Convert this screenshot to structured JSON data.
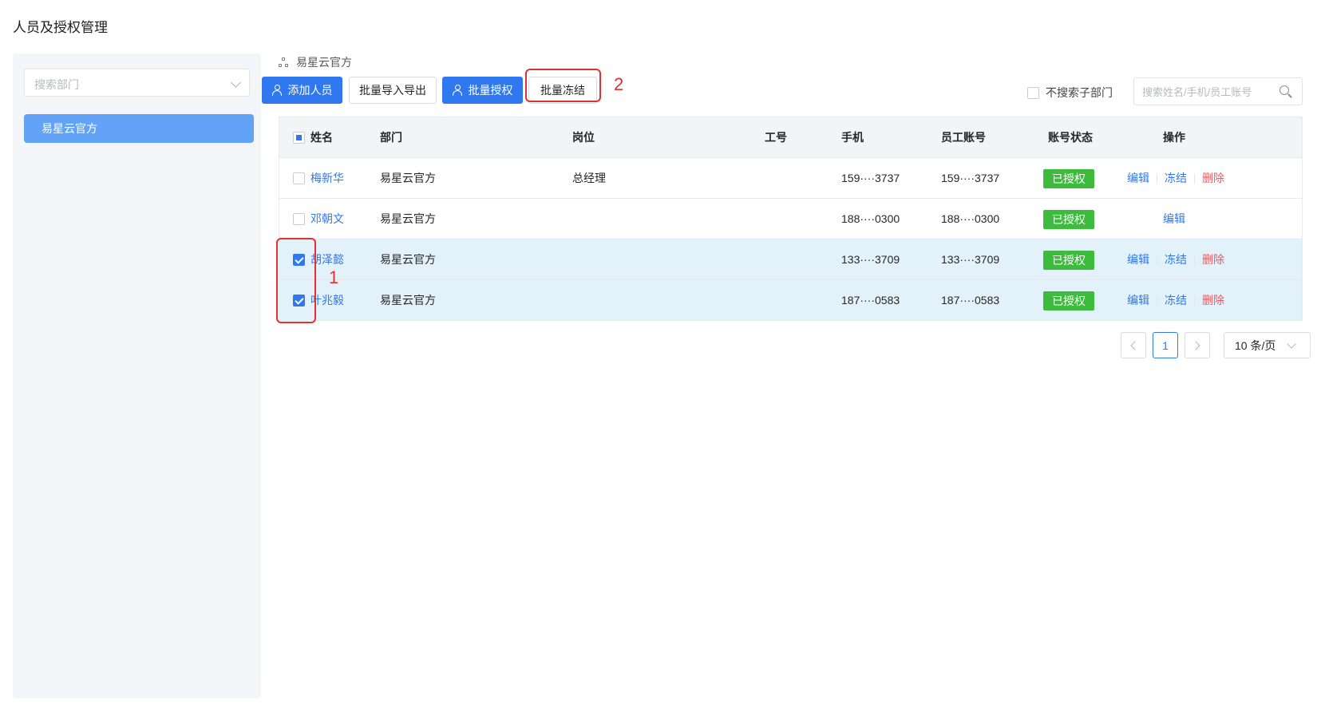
{
  "page": {
    "title": "人员及授权管理"
  },
  "sidebar": {
    "search_placeholder": "搜索部门",
    "departments": [
      {
        "label": "易星云官方",
        "selected": true
      }
    ]
  },
  "breadcrumb": {
    "label": "易星云官方"
  },
  "toolbar": {
    "add_person": "添加人员",
    "batch_import_export": "批量导入导出",
    "batch_authorize": "批量授权",
    "batch_freeze": "批量冻结",
    "exclude_subdept_label": "不搜索子部门",
    "exclude_subdept_checked": false,
    "search_placeholder": "搜索姓名/手机/员工账号"
  },
  "annotations": {
    "label_1": "1",
    "label_2": "2"
  },
  "table": {
    "headers": {
      "name": "姓名",
      "dept": "部门",
      "position": "岗位",
      "employee_no": "工号",
      "phone": "手机",
      "account": "员工账号",
      "status": "账号状态",
      "actions": "操作"
    },
    "select_all_state": "indeterminate",
    "rows": [
      {
        "checked": false,
        "name": "梅新华",
        "dept": "易星云官方",
        "position": "总经理",
        "employee_no": "",
        "phone": "159····3737",
        "account": "159····3737",
        "status": "已授权",
        "edit": "编辑",
        "freeze": "冻结",
        "delete": "删除"
      },
      {
        "checked": false,
        "name": "邓朝文",
        "dept": "易星云官方",
        "position": "",
        "employee_no": "",
        "phone": "188····0300",
        "account": "188····0300",
        "status": "已授权",
        "edit": "编辑",
        "freeze": "",
        "delete": ""
      },
      {
        "checked": true,
        "name": "胡泽懿",
        "dept": "易星云官方",
        "position": "",
        "employee_no": "",
        "phone": "133····3709",
        "account": "133····3709",
        "status": "已授权",
        "edit": "编辑",
        "freeze": "冻结",
        "delete": "删除"
      },
      {
        "checked": true,
        "name": "叶兆毅",
        "dept": "易星云官方",
        "position": "",
        "employee_no": "",
        "phone": "187····0583",
        "account": "187····0583",
        "status": "已授权",
        "edit": "编辑",
        "freeze": "冻结",
        "delete": "删除"
      }
    ]
  },
  "pagination": {
    "current_page": "1",
    "page_size": "10 条/页"
  },
  "colors": {
    "primary": "#2f78f0",
    "success": "#3dbb3d",
    "danger": "#f0575b",
    "highlight": "#e23030",
    "selected_row": "#e3f1fb"
  }
}
